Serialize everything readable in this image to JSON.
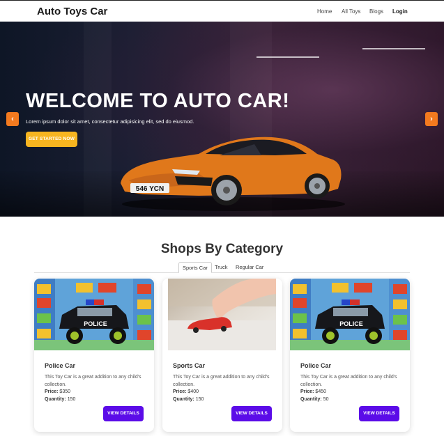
{
  "navbar": {
    "brand": "Auto Toys Car",
    "links": [
      "Home",
      "All Toys",
      "Blogs"
    ],
    "login": "Login"
  },
  "hero": {
    "title": "WELCOME TO AUTO CAR!",
    "subtitle": "Lorem ipsum dolor sit amet, consectetur adipisicing elit, sed do eiusmod.",
    "cta": "GET STARTED NOW",
    "plate": "546 YCN",
    "prev_icon": "chevron-left-icon",
    "next_icon": "chevron-right-icon",
    "accent": "#f37a1f",
    "cta_color": "#f7b520"
  },
  "category": {
    "title": "Shops By Category",
    "tabs": [
      "Sports Car",
      "Truck",
      "Regular Car"
    ],
    "active_tab": "Sports Car"
  },
  "products": [
    {
      "name": "Police Car",
      "desc": "This Toy Car is a great addition to any child's collection.",
      "price_label": "Price:",
      "price": "$350",
      "qty_label": "Quantity:",
      "qty": "150",
      "button": "VIEW DETAILS",
      "image": "police-toy-car"
    },
    {
      "name": "Sports Car",
      "desc": "This Toy Car is a great addition to any child's collection.",
      "price_label": "Price:",
      "price": "$400",
      "qty_label": "Quantity:",
      "qty": "150",
      "button": "VIEW DETAILS",
      "image": "red-sports-toy-car"
    },
    {
      "name": "Police Car",
      "desc": "This Toy Car is a great addition to any child's collection.",
      "price_label": "Price:",
      "price": "$450",
      "qty_label": "Quantity:",
      "qty": "50",
      "button": "VIEW DETAILS",
      "image": "police-toy-car"
    }
  ],
  "colors": {
    "button": "#5b0ce8"
  }
}
